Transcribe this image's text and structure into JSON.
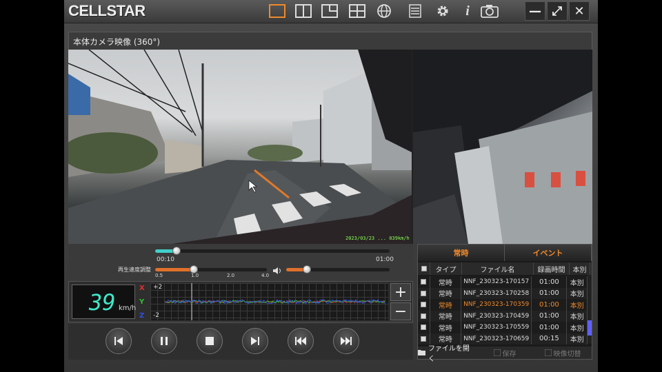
{
  "app": {
    "logo": "CELLSTAR",
    "toolbar_icons": [
      "single-view-icon",
      "split-view-icon",
      "pip-view-icon",
      "quad-view-icon",
      "globe-icon",
      "list-icon",
      "gear-icon",
      "info-icon",
      "camera-icon"
    ],
    "window_controls": {
      "minimize": "—",
      "maximize": "⤢",
      "close": "✕"
    }
  },
  "camera": {
    "title": "本体カメラ映像 (360°)",
    "stamp": "2023/03/23 ... 039km/h"
  },
  "playback": {
    "time_current": "00:10",
    "time_total": "01:00",
    "progress": 0.09,
    "speed_label": "再生速度調整",
    "speed_ticks": [
      "0.5",
      "1.0",
      "2.0",
      "4.0"
    ],
    "speed_value": "1.0",
    "volume": 0.2
  },
  "speedometer": {
    "value": "39",
    "unit": "km/h"
  },
  "gsensor": {
    "axes": [
      {
        "name": "X",
        "color": "#e03030"
      },
      {
        "name": "Y",
        "color": "#30c030"
      },
      {
        "name": "Z",
        "color": "#3050e0"
      }
    ],
    "scale_top": "+2",
    "scale_bottom": "-2",
    "zoom_in": "+",
    "zoom_out": "−"
  },
  "filelist": {
    "tabs": [
      "常時",
      "イベント"
    ],
    "columns": [
      "タイプ",
      "ファイル名",
      "録画時間",
      "本別"
    ],
    "rows": [
      {
        "type": "常時",
        "name": "NNF_230323-170157",
        "dur": "01:00",
        "kind": "本別",
        "selected": false
      },
      {
        "type": "常時",
        "name": "NNF_230323-170258",
        "dur": "01:00",
        "kind": "本別",
        "selected": false
      },
      {
        "type": "常時",
        "name": "NNF_230323-170359",
        "dur": "01:00",
        "kind": "本別",
        "selected": true
      },
      {
        "type": "常時",
        "name": "NNF_230323-170459",
        "dur": "01:00",
        "kind": "本別",
        "selected": false
      },
      {
        "type": "常時",
        "name": "NNF_230323-170559",
        "dur": "01:00",
        "kind": "本別",
        "selected": false
      },
      {
        "type": "常時",
        "name": "NNF_230323-170659",
        "dur": "00:15",
        "kind": "本別",
        "selected": false
      }
    ],
    "actions": {
      "open": "ファイルを開く",
      "save": "保存",
      "switch": "映像切替"
    }
  },
  "colors": {
    "accent": "#f08a2a",
    "speed": "#3fe8c8",
    "progress": "#3fd0c8"
  }
}
